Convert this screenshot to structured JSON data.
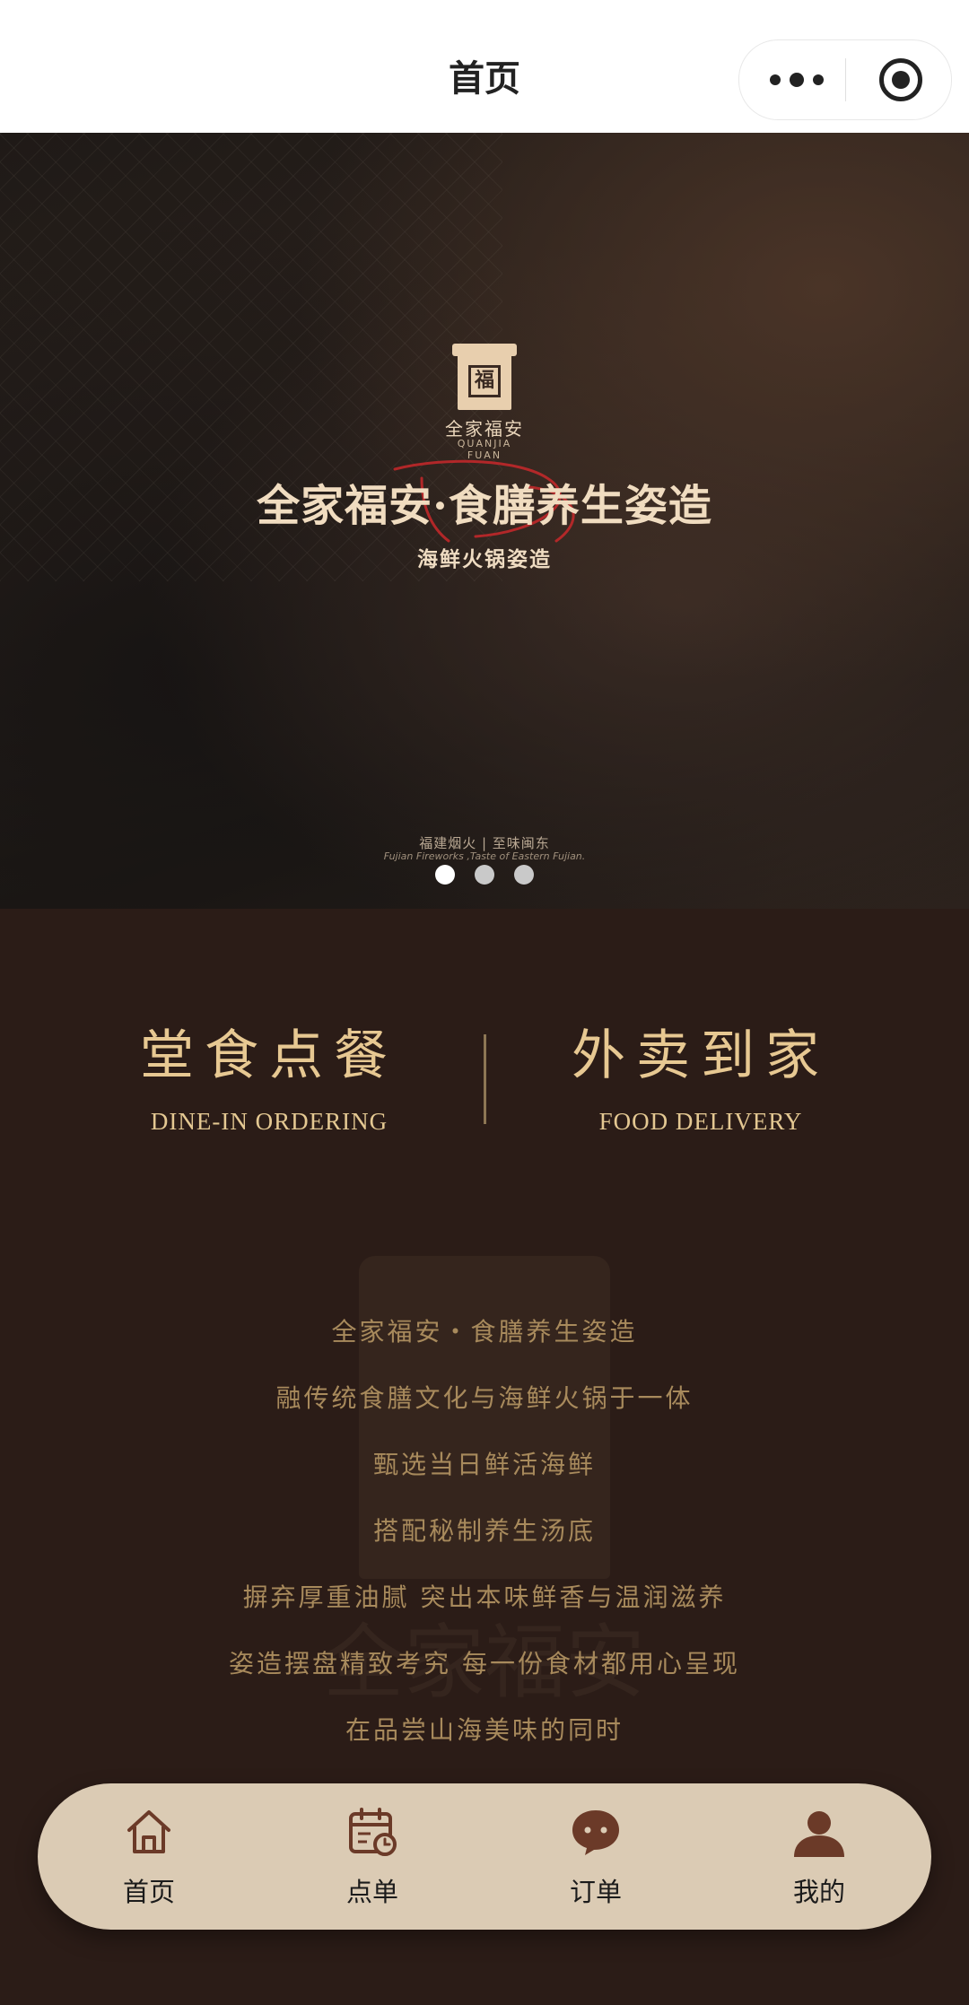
{
  "navbar": {
    "title": "首页",
    "capsule_icons": [
      "more-icon",
      "target-icon"
    ]
  },
  "banner": {
    "logo_cn": "全家福安",
    "logo_en_line1": "QUANJIA",
    "logo_en_line2": "FUAN",
    "headline": "全家福安·食膳养生姿造",
    "subheadline": "海鲜火锅姿造",
    "footer_cn": "福建烟火 | 至味闽东",
    "footer_en": "Fujian Fireworks ,Taste of Eastern Fujian.",
    "slides": 3,
    "active_slide": 1
  },
  "entries": {
    "dine_in": {
      "cn": "堂食点餐",
      "en": "DINE-IN ORDERING"
    },
    "delivery": {
      "cn": "外卖到家",
      "en": "FOOD DELIVERY"
    }
  },
  "intro": {
    "lines": [
      "全家福安・食膳养生姿造",
      "融传统食膳文化与海鲜火锅于一体",
      "甄选当日鲜活海鲜",
      "搭配秘制养生汤底",
      "摒弃厚重油腻 突出本味鲜香与温润滋养",
      "姿造摆盘精致考究 每一份食材都用心呈现",
      "在品尝山海美味的同时"
    ]
  },
  "tabbar": {
    "items": [
      {
        "label": "首页",
        "icon": "home-icon"
      },
      {
        "label": "点单",
        "icon": "calendar-clock-icon"
      },
      {
        "label": "订单",
        "icon": "chat-bubble-icon"
      },
      {
        "label": "我的",
        "icon": "user-icon"
      }
    ]
  },
  "colors": {
    "page_bg": "#2b1c17",
    "gold": "#e7c892",
    "muted_gold": "#a88a5c",
    "tabbar_bg": "#dbcbb4",
    "tab_icon": "#6b3a28"
  }
}
